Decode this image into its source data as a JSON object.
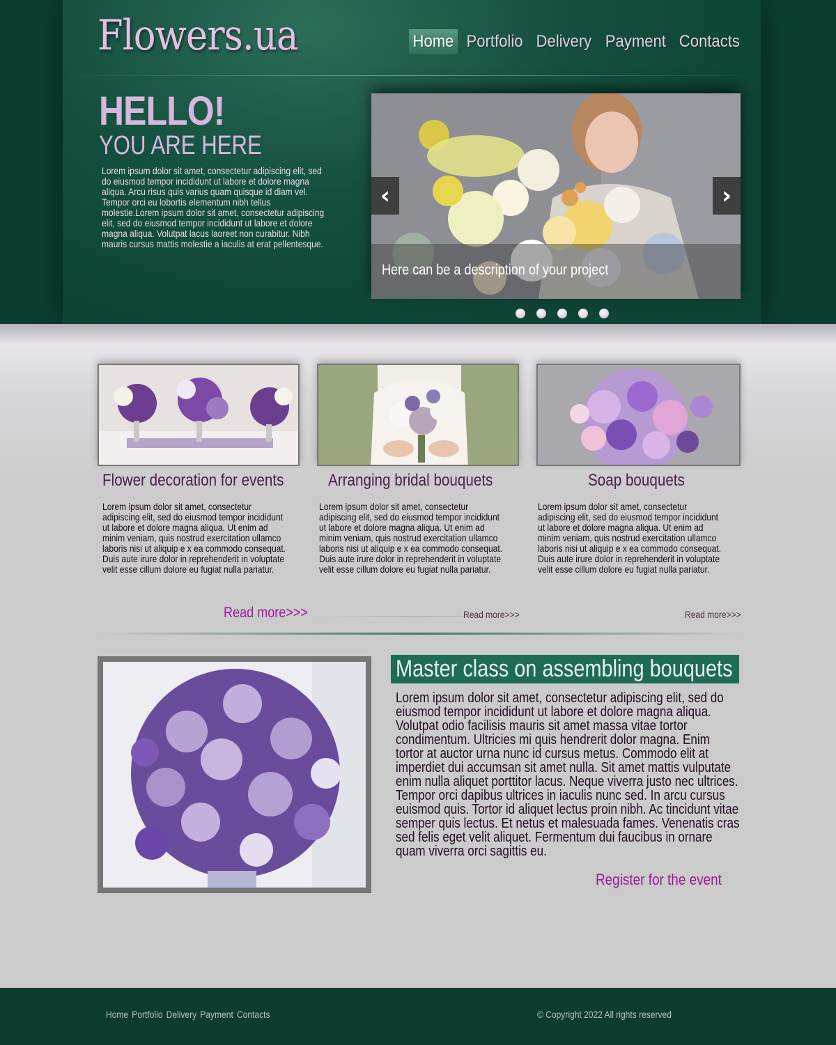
{
  "brand": {
    "logo": "Flowers.ua"
  },
  "nav": {
    "items": [
      {
        "label": "Home",
        "active": true
      },
      {
        "label": "Portfolio",
        "active": false
      },
      {
        "label": "Delivery",
        "active": false
      },
      {
        "label": "Payment",
        "active": false
      },
      {
        "label": "Contacts",
        "active": false
      }
    ]
  },
  "hero": {
    "title": "HELLO!",
    "subtitle": "YOU ARE HERE",
    "text": "Lorem ipsum dolor sit amet, consectetur adipiscing elit, sed do eiusmod tempor incididunt ut labore et dolore magna aliqua. Arcu risus quis varius quam quisque id diam vel. Tempor orci eu lobortis elementum nibh tellus molestie.Lorem ipsum dolor sit amet, consectetur adipiscing elit, sed do eiusmod tempor incididunt ut labore et dolore magna aliqua. Volutpat lacus laoreet non curabitur. Nibh mauris cursus mattis molestie a iaculis at erat pellentesque."
  },
  "slider": {
    "caption": "Here can be a description of your project",
    "prev_icon": "‹",
    "next_icon": "›",
    "dots": 5
  },
  "services": [
    {
      "title": "Flower decoration for events",
      "text": "Lorem ipsum dolor sit amet, consectetur adipiscing elit, sed do eiusmod tempor incididunt ut labore et dolore magna aliqua. Ut enim ad minim veniam, quis nostrud exercitation ullamco laboris nisi ut aliquip e x ea commodo consequat. Duis aute irure dolor in reprehenderit in voluptate velit esse cillum dolore eu fugiat nulla pariatur.",
      "read_more": "Read more>>>"
    },
    {
      "title": "Arranging bridal bouquets",
      "text": "Lorem ipsum dolor sit amet, consectetur adipiscing elit, sed do eiusmod tempor incididunt ut labore et dolore magna aliqua. Ut enim ad minim veniam, quis nostrud exercitation ullamco laboris nisi ut aliquip e x ea commodo consequat. Duis aute irure dolor in reprehenderit in voluptate velit esse cillum dolore eu fugiat nulla pariatur.",
      "read_more": "Read more>>>"
    },
    {
      "title": "Soap bouquets",
      "text": "Lorem ipsum dolor sit amet, consectetur adipiscing elit, sed do eiusmod tempor incididunt ut labore et dolore magna aliqua. Ut enim ad minim veniam, quis nostrud exercitation ullamco laboris nisi ut aliquip e x ea commodo consequat. Duis aute irure dolor in reprehenderit in voluptate velit esse cillum dolore eu fugiat nulla pariatur.",
      "read_more": "Read more>>>"
    }
  ],
  "master_class": {
    "heading": "Master class on assembling bouquets",
    "text": "Lorem ipsum dolor sit amet, consectetur adipiscing elit, sed do eiusmod tempor incididunt ut labore et dolore magna aliqua. Volutpat odio facilisis mauris sit amet massa vitae tortor condimentum. Ultricies mi quis hendrerit dolor magna. Enim tortor at auctor urna nunc id cursus metus. Commodo elit at imperdiet dui accumsan sit amet nulla. Sit amet mattis vulputate enim nulla aliquet porttitor lacus. Neque viverra justo nec ultrices. Tempor orci dapibus ultrices in iaculis nunc sed. In arcu cursus euismod quis. Tortor id aliquet lectus proin nibh. Ac tincidunt vitae semper quis lectus. Et netus et malesuada fames. Venenatis cras sed felis eget velit aliquet. Fermentum dui faucibus in ornare quam viverra orci sagittis eu.",
    "register": "Register for the event"
  },
  "footer": {
    "links": [
      "Home",
      "Portfolio",
      "Delivery",
      "Payment",
      "Contacts"
    ],
    "copyright": "© Copyright 2022  All rights reserved"
  },
  "colors": {
    "header_green": "#0d4434",
    "logo_pink": "#e6bfe4",
    "accent_magenta": "#a01a9a",
    "heading_green": "#1e6c56",
    "page_gray": "#cbcbcb"
  }
}
